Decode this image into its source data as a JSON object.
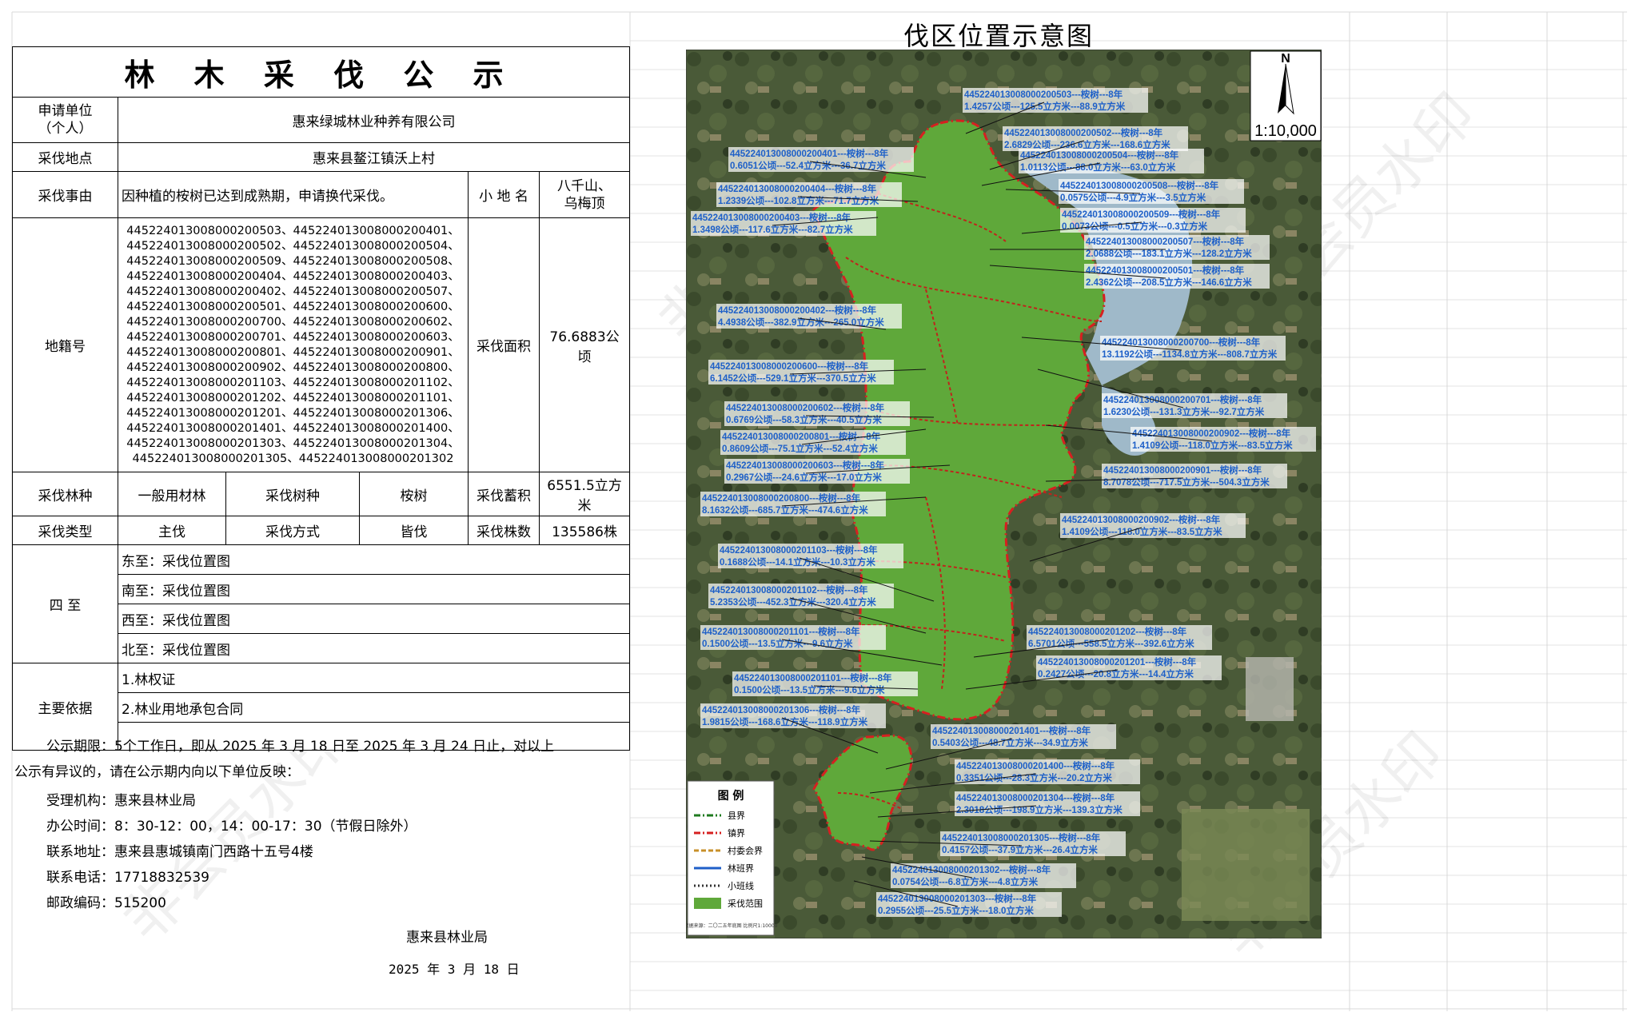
{
  "form": {
    "title": "林 木 采 伐 公 示",
    "applicant_label": "申请单位\n（个人）",
    "applicant": "惠来绿城林业种养有限公司",
    "location_label": "采伐地点",
    "location": "惠来县鳌江镇沃上村",
    "reason_label": "采伐事由",
    "reason": "因种植的桉树已达到成熟期，申请换代采伐。",
    "place_name_label": "小 地 名",
    "place_name": "八千山、\n乌梅顶",
    "cadastral_label": "地籍号",
    "cadastral_lines": [
      "445224013008000200503、445224013008000200401、",
      "445224013008000200502、445224013008000200504、",
      "445224013008000200509、445224013008000200508、",
      "445224013008000200404、445224013008000200403、",
      "445224013008000200402、445224013008000200507、",
      "445224013008000200501、445224013008000200600、",
      "445224013008000200700、445224013008000200602、",
      "445224013008000200701、445224013008000200603、",
      "445224013008000200801、445224013008000200901、",
      "445224013008000200902、445224013008000200800、",
      "445224013008000201103、445224013008000201102、",
      "445224013008000201202、445224013008000201101、",
      "445224013008000201201、445224013008000201306、",
      "445224013008000201401、445224013008000201400、",
      "445224013008000201303、445224013008000201304、",
      "445224013008000201305、445224013008000201302"
    ],
    "area_label": "采伐面积",
    "area": "76.6883公顷",
    "forest_type_label": "采伐林种",
    "forest_type": "一般用材林",
    "tree_species_label": "采伐树种",
    "tree_species": "桉树",
    "volume_label": "采伐蓄积",
    "volume": "6551.5立方米",
    "cut_type_label": "采伐类型",
    "cut_type": "主伐",
    "cut_method_label": "采伐方式",
    "cut_method": "皆伐",
    "stock_count_label": "采伐株数",
    "stock_count": "135586株",
    "boundaries_label": "四  至",
    "boundaries": [
      "东至：采伐位置图",
      "南至：采伐位置图",
      "西至：采伐位置图",
      "北至：采伐位置图"
    ],
    "basis_label": "主要依据",
    "basis": [
      "1.林权证",
      "2.林业用地承包合同"
    ]
  },
  "notice": {
    "period": "公示期限：5个工作日，即从 2025 年 3 月 18 日至 2025 年 3 月 24 日止，对以上",
    "period2": "公示有异议的，请在公示期内向以下单位反映：",
    "agency": "受理机构：惠来县林业局",
    "hours": "办公时间：8：30-12：00，14：00-17：30（节假日除外）",
    "address": "联系地址：惠来县惠城镇南门西路十五号4楼",
    "phone": "联系电话：17718832539",
    "postcode": "邮政编码：515200",
    "sign_org": "惠来县林业局",
    "sign_date": "2025 年 3 月 18 日"
  },
  "watermark": "非会员水印",
  "map": {
    "title": "伐区位置示意图",
    "north": "N",
    "scale": "1:10,000",
    "legend_title": "图  例",
    "legend": [
      {
        "label": "县界",
        "color": "#1f7a1f",
        "style": "dashdot"
      },
      {
        "label": "镇界",
        "color": "#d62020",
        "style": "dashdot"
      },
      {
        "label": "村委会界",
        "color": "#c8902a",
        "style": "dash"
      },
      {
        "label": "林班界",
        "color": "#1f5fc8",
        "style": "solid"
      },
      {
        "label": "小班线",
        "color": "#333333",
        "style": "dot"
      },
      {
        "label": "采伐范围",
        "color": "#5fa83a",
        "style": "fill"
      }
    ],
    "legend_note": "数据来源：二〇二五年底图\n比例尺1:10000",
    "labels": [
      {
        "id": "445224013008000200503---桉树---8年",
        "val": "1.4257公顷---125.5立方米---88.9立方米"
      },
      {
        "id": "445224013008000200502---桉树---8年",
        "val": "2.6829公顷---236.6立方米---168.6立方米"
      },
      {
        "id": "445224013008000200401---桉树---8年",
        "val": "0.6051公顷---52.4立方米---36.7立方米"
      },
      {
        "id": "445224013008000200504---桉树---8年",
        "val": "1.0113公顷---88.0立方米---63.0立方米"
      },
      {
        "id": "445224013008000200404---桉树---8年",
        "val": "1.2339公顷---102.8立方米---71.7立方米"
      },
      {
        "id": "445224013008000200508---桉树---8年",
        "val": "0.0575公顷---4.9立方米---3.5立方米"
      },
      {
        "id": "445224013008000200403---桉树---8年",
        "val": "1.3498公顷---117.6立方米---82.7立方米"
      },
      {
        "id": "445224013008000200509---桉树---8年",
        "val": "0.0073公顷---0.5立方米---0.3立方米"
      },
      {
        "id": "445224013008000200507---桉树---8年",
        "val": "2.0688公顷---183.1立方米---128.2立方米"
      },
      {
        "id": "445224013008000200501---桉树---8年",
        "val": "2.4362公顷---208.5立方米---146.6立方米"
      },
      {
        "id": "445224013008000200402---桉树---8年",
        "val": "4.4938公顷---382.9立方米---265.0立方米"
      },
      {
        "id": "445224013008000200700---桉树---8年",
        "val": "13.1192公顷---1134.8立方米---808.7立方米"
      },
      {
        "id": "445224013008000200600---桉树---8年",
        "val": "6.1452公顷---529.1立方米---370.5立方米"
      },
      {
        "id": "445224013008000200701---桉树---8年",
        "val": "1.6230公顷---131.3立方米---92.7立方米"
      },
      {
        "id": "445224013008000200602---桉树---8年",
        "val": "0.6769公顷---58.3立方米---40.5立方米"
      },
      {
        "id": "445224013008000200902---桉树---8年",
        "val": "1.4109公顷---118.0立方米---83.5立方米"
      },
      {
        "id": "445224013008000200801---桉树---8年",
        "val": "0.8609公顷---75.1立方米---52.4立方米"
      },
      {
        "id": "445224013008000200603---桉树---8年",
        "val": "0.2967公顷---24.6立方米---17.0立方米"
      },
      {
        "id": "445224013008000200901---桉树---8年",
        "val": "8.7078公顷---717.5立方米---504.3立方米"
      },
      {
        "id": "445224013008000200800---桉树---8年",
        "val": "8.1632公顷---685.7立方米---474.6立方米"
      },
      {
        "id": "445224013008000200902---桉树---8年",
        "val": "1.4109公顷---118.0立方米---83.5立方米"
      },
      {
        "id": "445224013008000201103---桉树---8年",
        "val": "0.1688公顷---14.1立方米---10.3立方米"
      },
      {
        "id": "445224013008000201102---桉树---8年",
        "val": "5.2353公顷---452.3立方米---320.4立方米"
      },
      {
        "id": "445224013008000201101---桉树---8年",
        "val": "0.1500公顷---13.5立方米---9.6立方米"
      },
      {
        "id": "445224013008000201202---桉树---8年",
        "val": "6.5701公顷---558.5立方米---392.6立方米"
      },
      {
        "id": "445224013008000201201---桉树---8年",
        "val": "0.2427公顷---20.8立方米---14.4立方米"
      },
      {
        "id": "445224013008000201101---桉树---8年",
        "val": "0.1500公顷---13.5立方米---9.6立方米"
      },
      {
        "id": "445224013008000201306---桉树---8年",
        "val": "1.9815公顷---168.6立方米---118.9立方米"
      },
      {
        "id": "445224013008000201401---桉树---8年",
        "val": "0.5403公顷---48.7立方米---34.9立方米"
      },
      {
        "id": "445224013008000201400---桉树---8年",
        "val": "0.3351公顷---28.3立方米---20.2立方米"
      },
      {
        "id": "445224013008000201304---桉树---8年",
        "val": "2.3018公顷---198.9立方米---139.3立方米"
      },
      {
        "id": "445224013008000201305---桉树---8年",
        "val": "0.4157公顷---37.9立方米---26.4立方米"
      },
      {
        "id": "445224013008000201302---桉树---8年",
        "val": "0.0754公顷---6.8立方米---4.8立方米"
      },
      {
        "id": "445224013008000201303---桉树---8年",
        "val": "0.2955公顷---25.5立方米---18.0立方米"
      }
    ]
  }
}
